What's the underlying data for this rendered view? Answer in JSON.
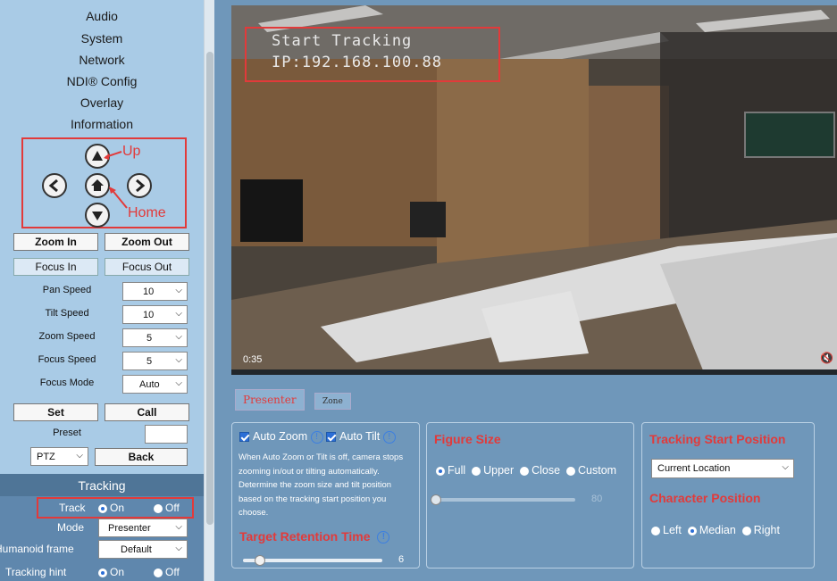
{
  "sidebar": {
    "menu": [
      "Audio",
      "System",
      "Network",
      "NDI® Config",
      "Overlay",
      "Information"
    ],
    "ptz_annotations": {
      "up": "Up",
      "home": "Home"
    },
    "zoom_in": "Zoom In",
    "zoom_out": "Zoom Out",
    "focus_in": "Focus In",
    "focus_out": "Focus Out",
    "speeds": [
      {
        "label": "Pan Speed",
        "value": "10"
      },
      {
        "label": "Tilt Speed",
        "value": "10"
      },
      {
        "label": "Zoom Speed",
        "value": "5"
      },
      {
        "label": "Focus Speed",
        "value": "5"
      },
      {
        "label": "Focus Mode",
        "value": "Auto"
      }
    ],
    "set": "Set",
    "call": "Call",
    "preset_label": "Preset",
    "preset_value": "",
    "ptz_select": "PTZ",
    "back": "Back",
    "tracking_header": "Tracking",
    "track_label": "Track",
    "on": "On",
    "off": "Off",
    "mode_label": "Mode",
    "mode_value": "Presenter",
    "humanoid_label": "Humanoid frame",
    "humanoid_value": "Default",
    "hint_label": "Tracking hint"
  },
  "video": {
    "osd_line1": "Start Tracking",
    "osd_line2": "IP:192.168.100.88",
    "timecode": "0:35"
  },
  "tabs": {
    "presenter": "Presenter",
    "zone": "Zone"
  },
  "auto_panel": {
    "auto_zoom": "Auto Zoom",
    "auto_tilt": "Auto Tilt",
    "description": "When Auto Zoom or Tilt is off, camera stops zooming in/out or tilting automatically. Determine the zoom size and tilt position based on the tracking start position you choose.",
    "retention_title": "Target Retention Time",
    "retention_value": "6",
    "retention_level": 0.12
  },
  "figure_panel": {
    "title": "Figure Size",
    "options": [
      "Full",
      "Upper",
      "Close",
      "Custom"
    ],
    "selected": "Full",
    "slider_value": "80",
    "slider_level": 0.0
  },
  "position_panel": {
    "tracking_title": "Tracking Start Position",
    "tracking_value": "Current Location",
    "character_title": "Character Position",
    "options": [
      "Left",
      "Median",
      "Right"
    ],
    "selected": "Median"
  }
}
